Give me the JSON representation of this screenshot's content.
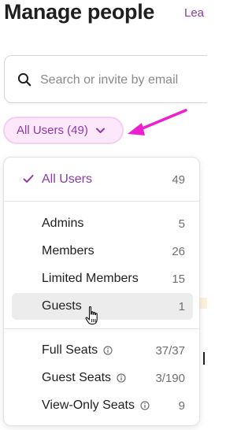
{
  "header": {
    "title": "Manage people",
    "learn_link": "Lea"
  },
  "search": {
    "placeholder": "Search or invite by email",
    "value": ""
  },
  "filter": {
    "selected_label": "All Users (49)"
  },
  "dropdown": {
    "groups": [
      [
        {
          "label": "All Users",
          "count": "49",
          "selected": true
        }
      ],
      [
        {
          "label": "Admins",
          "count": "5"
        },
        {
          "label": "Members",
          "count": "26"
        },
        {
          "label": "Limited Members",
          "count": "15"
        },
        {
          "label": "Guests",
          "count": "1",
          "hovered": true
        }
      ],
      [
        {
          "label": "Full Seats",
          "count": "37/37",
          "info": true
        },
        {
          "label": "Guest Seats",
          "count": "3/190",
          "info": true
        },
        {
          "label": "View-Only Seats",
          "count": "9",
          "info": true
        }
      ]
    ]
  },
  "colors": {
    "accent": "#8e3aa8",
    "chip_bg": "#fde8fb",
    "annotation_arrow": "#ee1fd0",
    "hover_row": "#ececec"
  },
  "icons": [
    "search-icon",
    "chevron-down-icon",
    "check-icon",
    "info-icon",
    "hand-cursor-icon",
    "annotation-arrow"
  ]
}
